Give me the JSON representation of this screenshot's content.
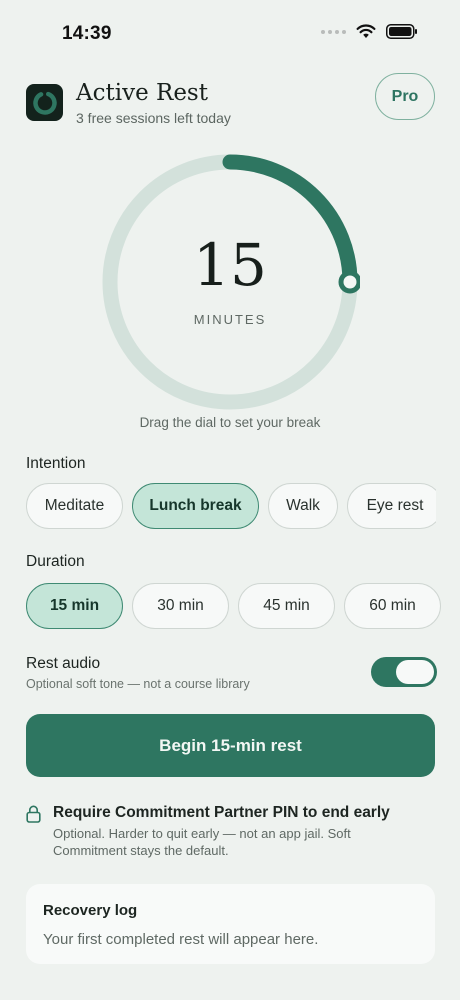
{
  "status_bar": {
    "time": "14:39"
  },
  "header": {
    "title": "Active Rest",
    "subtitle": "3 free sessions left today",
    "pro_label": "Pro"
  },
  "dial": {
    "value": "15",
    "unit": "MINUTES",
    "hint": "Drag the dial to set your break",
    "progress_fraction": 0.25
  },
  "intention": {
    "label": "Intention",
    "options": [
      "Meditate",
      "Lunch break",
      "Walk",
      "Eye rest"
    ],
    "selected": "Lunch break"
  },
  "duration": {
    "label": "Duration",
    "options": [
      "15 min",
      "30 min",
      "45 min",
      "60 min"
    ],
    "selected": "15 min"
  },
  "audio": {
    "title": "Rest audio",
    "subtitle": "Optional soft tone — not a course library",
    "enabled": true
  },
  "begin_label": "Begin 15-min rest",
  "commitment": {
    "title": "Require Commitment Partner PIN to end early",
    "subtitle": "Optional. Harder to quit early — not an app jail. Soft Commitment stays the default."
  },
  "recovery_log": {
    "title": "Recovery log",
    "empty_text": "Your first completed rest will appear here."
  },
  "colors": {
    "accent": "#2e7661",
    "track": "#d3e1db",
    "chip_selected": "#c4e5d8",
    "background": "#eef2ef"
  }
}
